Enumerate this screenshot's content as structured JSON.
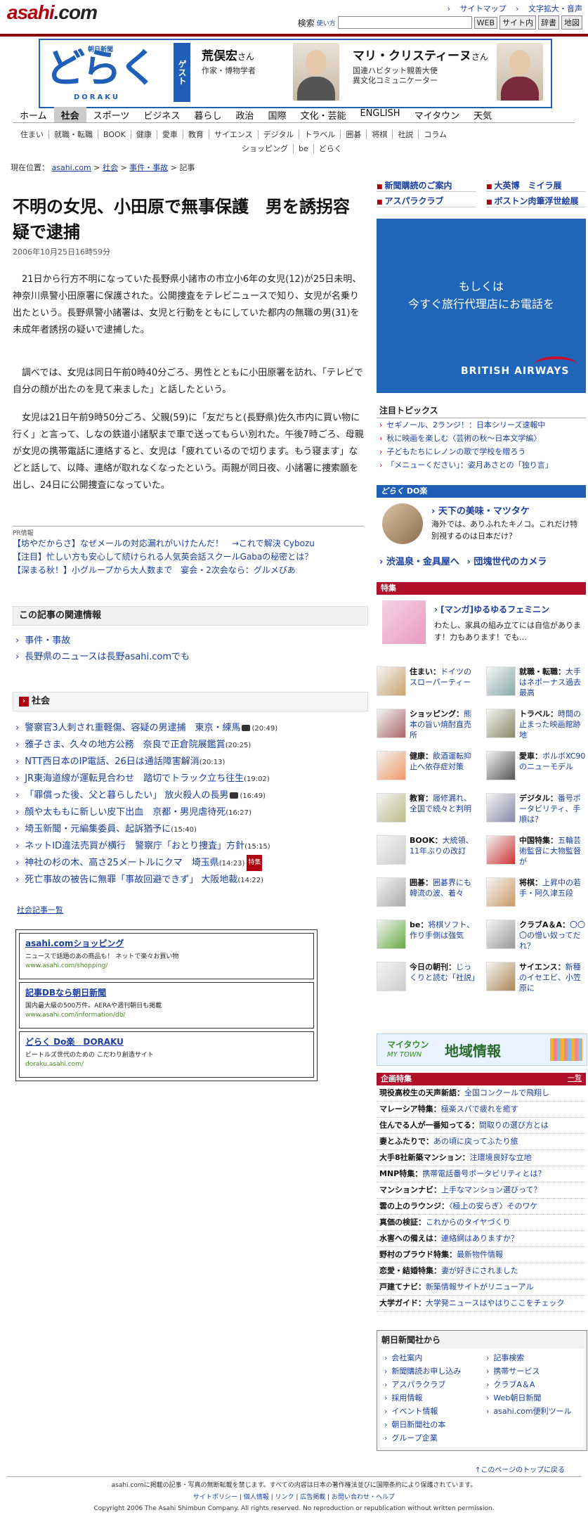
{
  "header": {
    "logo_prefix": "asahi",
    "logo_suffix": ".com",
    "toplinks": [
      "サイトマップ",
      "文字拡大・音声"
    ],
    "search_label": "検索",
    "search_howto": "使い方",
    "search_buttons": [
      "WEB",
      "サイト内",
      "辞書",
      "地図"
    ]
  },
  "banner": {
    "logo_top": "朝日新聞",
    "logo_main": "どらく",
    "logo_sub": "DORAKU",
    "guest_tag": "ゲスト",
    "guest1": {
      "name": "荒俣宏",
      "suffix": "さん",
      "role": "作家・博物学者"
    },
    "guest2": {
      "name": "マリ・クリスティーヌ",
      "suffix": "さん",
      "role1": "国連ハビタット親善大使",
      "role2": "異文化コミュニケーター"
    }
  },
  "nav_primary": [
    "ホーム",
    "社会",
    "スポーツ",
    "ビジネス",
    "暮らし",
    "政治",
    "国際",
    "文化・芸能",
    "ENGLISH",
    "マイタウン",
    "天気"
  ],
  "nav_secondary_row1": [
    "住まい",
    "就職・転職",
    "BOOK",
    "健康",
    "愛車",
    "教育",
    "サイエンス",
    "デジタル",
    "トラベル",
    "囲碁",
    "将棋",
    "社説",
    "コラム"
  ],
  "nav_secondary_row2": [
    "ショッピング",
    "be",
    "どらく"
  ],
  "breadcrumb": {
    "label": "現在位置：",
    "items": [
      "asahi.com",
      "社会",
      "事件・事故"
    ],
    "current": "記事"
  },
  "article": {
    "title": "不明の女児、小田原で無事保護　男を誘拐容疑で逮捕",
    "date": "2006年10月25日16時59分",
    "p1": "　21日から行方不明になっていた長野県小諸市の市立小6年の女児(12)が25日未明、神奈川県警小田原署に保護された。公開捜査をテレビニュースで知り、女児が名乗り出たという。長野県警小諸署は、女児と行動をともにしていた都内の無職の男(31)を未成年者誘拐の疑いで逮捕した。",
    "p2": "　調べでは、女児は同日午前0時40分ごろ、男性とともに小田原署を訪れ、「テレビで自分の顔が出たのを見て来ました」と話したという。",
    "p3": "　女児は21日午前9時50分ごろ、父親(59)に「友だちと(長野県)佐久市内に買い物に行く」と言って、しなの鉄道小諸駅まで車で送ってもらい別れた。午後7時ごろ、母親が女児の携帯電話に連絡すると、女児は「疲れているので切ります。もう寝ます」などと話して、以降、連絡が取れなくなったという。両親が同日夜、小諸署に捜索願を出し、24日に公開捜査になっていた。"
  },
  "pr": {
    "label": "PR情報",
    "items": [
      "【坊やだからさ】なぜメールの対応漏れがいけたんだ！　→これで解決 Cybozu",
      "【注目】忙しい方も安心して続けられる人気英会話スクールGabaの秘密とは？",
      "【深まる秋！】小グループから大人数まで　宴会・2次会なら：グルメぴあ"
    ]
  },
  "related": {
    "heading": "この記事の関連情報",
    "items": [
      "事件・事故",
      "長野県のニュースは長野asahi.comでも"
    ]
  },
  "society": {
    "heading": "社会",
    "items": [
      {
        "text": "警察官3人刺され重軽傷、容疑の男逮捕　東京・練馬",
        "cam": true,
        "time": "(20:49)"
      },
      {
        "text": "雅子さま、久々の地方公務　奈良で正倉院展鑑賞",
        "time": "(20:25)"
      },
      {
        "text": "NTT西日本のIP電話、26日は通話障害解消",
        "time": "(20:13)"
      },
      {
        "text": "JR東海道線が運転見合わせ　踏切でトラック立ち往生",
        "time": "(19:02)"
      },
      {
        "text": "「罪償った後、父と暮らしたい」 放火殺人の長男",
        "cam": true,
        "time": "(16:49)"
      },
      {
        "text": "顔や太ももに新しい皮下出血　京都・男児虐待死",
        "time": "(16:27)"
      },
      {
        "text": "埼玉新聞・元編集委員、起訴猶予に",
        "time": "(15:40)"
      },
      {
        "text": "ネットID違法売買が横行　警察庁「おとり捜査」方針",
        "time": "(15:15)"
      },
      {
        "text": "神社の杉の木、高さ25メートルにクマ　埼玉県",
        "time": "(14:23)",
        "tag": "特集"
      },
      {
        "text": "死亡事故の被告に無罪「事故回避できず」 大阪地裁",
        "time": "(14:22)"
      }
    ],
    "more": "社会記事一覧"
  },
  "ads": [
    {
      "title": "asahi.comショッピング",
      "desc": "ニュースで話題のあの商品も！ ネットで楽々お買い物",
      "url": "www.asahi.com/shopping/"
    },
    {
      "title": "記事DBなら朝日新聞",
      "desc": "国内最大級の500万件。AERAや週刊朝日も掲載",
      "url": "www.asahi.com/information/db/"
    },
    {
      "title": "どらく Do楽　DORAKU",
      "desc": "ビートルズ世代のための こだわり創造サイト",
      "url": "doraku.asahi.com/"
    }
  ],
  "right": {
    "quick_links": [
      "新聞購読のご案内",
      "大英博　ミイラ展",
      "アスパラクラブ",
      "ボストン肉筆浮世絵展"
    ],
    "ba_ad": {
      "line1": "もしくは",
      "line2": "今すぐ旅行代理店にお電話を",
      "logo": "BRITISH AIRWAYS"
    },
    "topics": {
      "heading": "注目トピックス",
      "items": [
        "セギノール、2ランジ！：日本シリーズ速報中",
        "秋に映画を楽しむ〈芸術の秋〜日本文学編〉",
        "子どもたちにレノンの歌で学校を贈ろう",
        "「メニューください」：姿月あさとの「独り言」"
      ]
    },
    "doraku": {
      "bar": "DO楽",
      "headline": "天下の美味・マツタケ",
      "desc": "海外では、ありふれたキノコ。これだけ特別視するのは日本だけ？",
      "links": [
        "渋温泉・金具屋へ",
        "団塊世代のカメラ"
      ]
    },
    "tokushu": {
      "bar": "特集",
      "headline": "[マンガ]ゆるゆるフェミニン",
      "desc": "わたし、家具の組み立てには自信があります！力もあります！でも…"
    },
    "grid": [
      {
        "cat": "住まい：",
        "text": "ドイツのスローパーティー"
      },
      {
        "cat": "就職・転職：",
        "text": "大手はネポーナス過去最高"
      },
      {
        "cat": "ショッピング：",
        "text": "熊本の旨い焼酎直売所"
      },
      {
        "cat": "トラベル：",
        "text": "時間の止まった映画館跡地"
      },
      {
        "cat": "健康：",
        "text": "飲酒運転抑止へ依存症対策"
      },
      {
        "cat": "愛車：",
        "text": "ボルボXC90のニューモデル"
      },
      {
        "cat": "教育：",
        "text": "履修漏れ、全国で続々と判明"
      },
      {
        "cat": "デジタル：",
        "text": "番号ポータビリティ、手順は？"
      },
      {
        "cat": "BOOK：",
        "text": "大統領、11年ぶりの改訂"
      },
      {
        "cat": "中国特集：",
        "text": "五輪芸術監督に大物監督が"
      },
      {
        "cat": "囲碁：",
        "text": "囲碁界にも韓流の波、着々"
      },
      {
        "cat": "将棋：",
        "text": "上昇中の若手・阿久津五段"
      },
      {
        "cat": "be：",
        "text": "将棋ソフト、作り手側は強気"
      },
      {
        "cat": "クラブA＆A：",
        "text": "〇〇〇の憎い奴ってだれ？"
      },
      {
        "cat": "今日の朝刊：",
        "text": "じっくりと読む「社説」"
      },
      {
        "cat": "サイエンス：",
        "text": "新種のイセエビ、小笠原に"
      }
    ],
    "mytown": {
      "label": "マイタウン",
      "sub": "MY TOWN",
      "title": "地域情報"
    },
    "kikaku": {
      "heading": "企画特集",
      "more": "一覧",
      "items": [
        {
          "b": "現役高校生の天声新語：",
          "t": "全国コンクールで飛翔し"
        },
        {
          "b": "マレーシア特集：",
          "t": "極楽スパで疲れを癒す"
        },
        {
          "b": "住んでる人が一番知ってる：",
          "t": "間取りの選び方とは"
        },
        {
          "b": "妻とふたりで：",
          "t": "あの頃に戻ってふたり旅"
        },
        {
          "b": "大手8社新築マンション：",
          "t": "注環境良好な立地"
        },
        {
          "b": "MNP特集：",
          "t": "携帯電話番号ポータビリティとは？"
        },
        {
          "b": "マンションナビ：",
          "t": "上手なマンション選びって？"
        },
        {
          "b": "雲の上のラウンジ：",
          "t": "〈極上の安らぎ〉そのワケ"
        },
        {
          "b": "真価の検証：",
          "t": "これからのタイヤづくり"
        },
        {
          "b": "水害への備えは：",
          "t": "連絡網はありますか？"
        },
        {
          "b": "野村のプラウド特集：",
          "t": "最新物件情報"
        },
        {
          "b": "恋愛・結婚特集：",
          "t": "妻が好きにされました"
        },
        {
          "b": "戸建てナビ：",
          "t": "新築情報サイトがリニューアル"
        },
        {
          "b": "大学ガイド：",
          "t": "大学発ニュースはやはりここをチェック"
        }
      ]
    },
    "asahi_from": {
      "heading": "朝日新聞社から",
      "items": [
        "会社案内",
        "記事検索",
        "新聞購読お申し込み",
        "携帯サービス",
        "アスパラクラブ",
        "クラブA＆A",
        "採用情報",
        "Web朝日新聞",
        "イベント情報",
        "asahi.com便利ツール",
        "朝日新聞社の本",
        "",
        "グループ企業",
        ""
      ]
    },
    "page_top": "↑このページのトップに戻る"
  },
  "footer": {
    "notice": "asahi.comに掲載の記事・写真の無断転載を禁じます。すべての内容は日本の著作権法並びに国際条約により保護されています。",
    "links": [
      "サイトポリシー",
      "個人情報",
      "リンク",
      "広告掲載",
      "お問い合わせ・ヘルプ"
    ],
    "copyright": "Copyright 2006 The Asahi Shimbun Company. All rights reserved. No reproduction or republication without written permission."
  }
}
